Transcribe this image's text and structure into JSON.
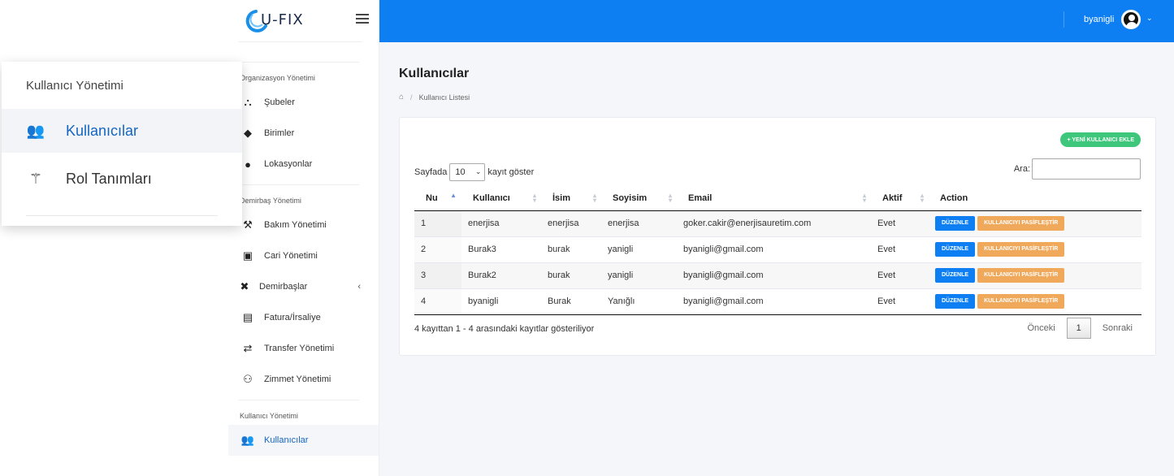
{
  "brand": {
    "logo_text": "U-FIX"
  },
  "topbar": {
    "username": "byanigli"
  },
  "sidebar": {
    "sections": [
      {
        "title": "Organizasyon Yönetimi",
        "items": [
          {
            "label": "Şubeler",
            "icon": "sitemap-icon"
          },
          {
            "label": "Birimler",
            "icon": "building-icon"
          },
          {
            "label": "Lokasyonlar",
            "icon": "map-marker-icon"
          }
        ]
      },
      {
        "title": "Demirbaş Yönetimi",
        "items": [
          {
            "label": "Bakım Yönetimi",
            "icon": "hammer-icon"
          },
          {
            "label": "Cari Yönetimi",
            "icon": "address-card-icon"
          },
          {
            "label": "Demirbaşlar",
            "icon": "tools-icon"
          },
          {
            "label": "Fatura/İrsaliye",
            "icon": "invoice-icon"
          },
          {
            "label": "Transfer Yönetimi",
            "icon": "exchange-icon"
          },
          {
            "label": "Zimmet Yönetimi",
            "icon": "people-arrows-icon"
          }
        ]
      },
      {
        "title": "Kullanıcı Yönetimi",
        "items": [
          {
            "label": "Kullanıcılar",
            "icon": "users-icon"
          }
        ]
      }
    ]
  },
  "floating_menu": {
    "title": "Kullanıcı Yönetimi",
    "items": [
      {
        "label": "Kullanıcılar",
        "icon": "users-icon"
      },
      {
        "label": "Rol Tanımları",
        "icon": "magic-wand-icon"
      }
    ]
  },
  "page": {
    "title": "Kullanıcılar",
    "breadcrumb": "Kullanıcı Listesi",
    "new_button": "+ YENİ KULLANICI EKLE"
  },
  "table_controls": {
    "show_prefix": "Sayfada",
    "page_length": "10",
    "show_suffix": "kayıt göster",
    "search_label": "Ara:",
    "search_value": ""
  },
  "table": {
    "columns": [
      "Nu",
      "Kullanıcı",
      "İsim",
      "Soyisim",
      "Email",
      "Aktif",
      "Action"
    ],
    "rows": [
      {
        "nu": "1",
        "kullanici": "enerjisa",
        "isim": "enerjisa",
        "soyisim": "enerjisa",
        "email": "goker.cakir@enerjisauretim.com",
        "aktif": "Evet"
      },
      {
        "nu": "2",
        "kullanici": "Burak3",
        "isim": "burak",
        "soyisim": "yanigli",
        "email": "byanigli@gmail.com",
        "aktif": "Evet"
      },
      {
        "nu": "3",
        "kullanici": "Burak2",
        "isim": "burak",
        "soyisim": "yanigli",
        "email": "byanigli@gmail.com",
        "aktif": "Evet"
      },
      {
        "nu": "4",
        "kullanici": "byanigli",
        "isim": "Burak",
        "soyisim": "Yanığlı",
        "email": "byanigli@gmail.com",
        "aktif": "Evet"
      }
    ],
    "edit_label": "DÜZENLE",
    "deactivate_label": "KULLANICIYI PASİFLEŞTİR"
  },
  "footer": {
    "info": "4 kayıttan 1 - 4 arasındaki kayıtlar gösteriliyor",
    "prev": "Önceki",
    "page": "1",
    "next": "Sonraki"
  },
  "colors": {
    "topbar": "#0d7ff2",
    "primary": "#0d7ff2",
    "success": "#3ec77a",
    "warning": "#f0a85a"
  }
}
